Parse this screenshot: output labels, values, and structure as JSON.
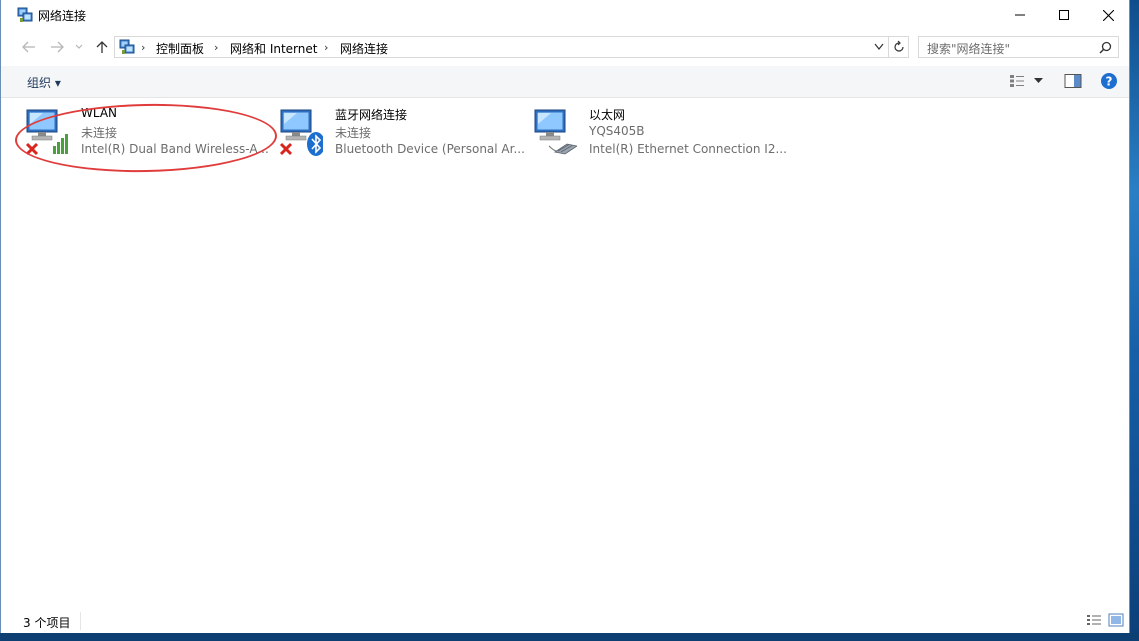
{
  "window": {
    "title": "网络连接",
    "minimize_glyph": "—",
    "maximize_glyph": "☐",
    "close_glyph": "✕"
  },
  "nav": {
    "back_icon": "back-arrow-icon",
    "forward_icon": "forward-arrow-icon",
    "recent_icon": "chevron-down-icon",
    "up_icon": "up-arrow-icon"
  },
  "address": {
    "breadcrumbs": [
      "控制面板",
      "网络和 Internet",
      "网络连接"
    ],
    "separator": "›"
  },
  "search": {
    "placeholder": "搜索\"网络连接\""
  },
  "toolbar": {
    "organize_label": "组织 ▾"
  },
  "connections": [
    {
      "name": "WLAN",
      "status": "未连接",
      "device": "Intel(R) Dual Band Wireless-A...",
      "type": "wireless",
      "disconnected": true
    },
    {
      "name": "蓝牙网络连接",
      "status": "未连接",
      "device": "Bluetooth Device (Personal Ar...",
      "type": "bluetooth",
      "disconnected": true
    },
    {
      "name": "以太网",
      "status": "YQS405B",
      "device": "Intel(R) Ethernet Connection I2...",
      "type": "ethernet",
      "disconnected": false
    }
  ],
  "statusbar": {
    "item_count": "3 个项目"
  },
  "colors": {
    "accent": "#1e395b",
    "annotation": "#e03c3c",
    "help": "#1c6fcf"
  }
}
